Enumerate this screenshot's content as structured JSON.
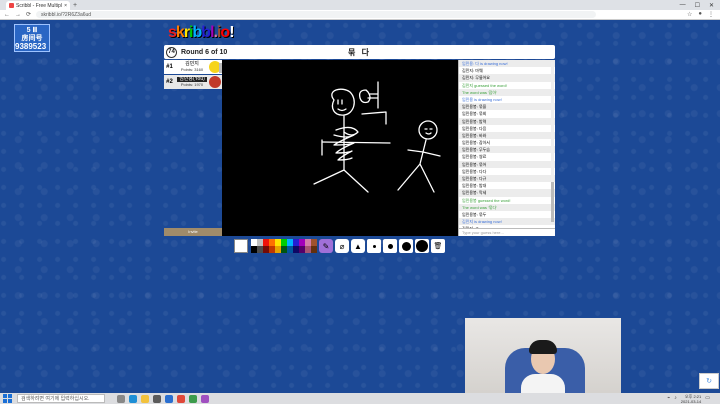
{
  "browser": {
    "tab_title": "Scribbl - Free Multiplayer Draw",
    "new_tab": "+",
    "url": "skribbl.io/?2R6Z3a6ud",
    "nav_back": "←",
    "nav_fwd": "→",
    "nav_reload": "⟳",
    "win_min": "—",
    "win_max": "☐",
    "win_close": "✕"
  },
  "sticker": {
    "line1": "5 Ⅲ",
    "line2": "房间号",
    "room_number": "9389523"
  },
  "logo": {
    "letters": [
      "s",
      "k",
      "r",
      "i",
      "b",
      "b",
      "l",
      ".",
      "i",
      "o",
      "!"
    ],
    "colors": [
      "#ef1f1f",
      "#ff7c00",
      "#ffe400",
      "#00cc00",
      "#00b2ff",
      "#231fd3",
      "#a300ba",
      "#d37caa",
      "#a0522d",
      "#ff0000",
      "#ffffff"
    ]
  },
  "header": {
    "timer": "74",
    "round": "Round 6 of 10",
    "word": "묶 다"
  },
  "players": [
    {
      "rank": "#1",
      "name": "김민지",
      "points": "Points: 3160",
      "avatar": "y"
    },
    {
      "rank": "#2",
      "name": "임민용(You)",
      "points": "Points: 1970",
      "avatar": "r"
    }
  ],
  "under_label": "Invite",
  "chat": {
    "messages": [
      {
        "text": "임민용: 다 is drawing now!",
        "cls": "b"
      },
      {
        "text": "김민지: 마웨",
        "cls": ""
      },
      {
        "text": "김민지: 무릎어요",
        "cls": ""
      },
      {
        "text": "김민지 guessed the word!",
        "cls": "g"
      },
      {
        "text": "The word was '잡아'",
        "cls": "g"
      },
      {
        "text": "임민용 is drawing now!",
        "cls": "b"
      },
      {
        "text": "임민용봉: 묶을",
        "cls": ""
      },
      {
        "text": "임민용봉: 묶회",
        "cls": ""
      },
      {
        "text": "임민용봉: 밤력",
        "cls": ""
      },
      {
        "text": "임민용봉: 다음",
        "cls": ""
      },
      {
        "text": "임민용봉: 바와",
        "cls": ""
      },
      {
        "text": "임민용봉: 잡아서",
        "cls": ""
      },
      {
        "text": "임민용봉: 무두습",
        "cls": ""
      },
      {
        "text": "임민용봉: 쌍료",
        "cls": ""
      },
      {
        "text": "임민용봉: 묶어",
        "cls": ""
      },
      {
        "text": "임민용봉: 다다",
        "cls": ""
      },
      {
        "text": "임민용봉: 다규",
        "cls": ""
      },
      {
        "text": "임민용봉: 밤대",
        "cls": ""
      },
      {
        "text": "임민용봉: 막세",
        "cls": ""
      },
      {
        "text": "임민용봉 guessed the word!",
        "cls": "g"
      },
      {
        "text": "The word was '묶다'",
        "cls": "g"
      },
      {
        "text": "임민용봉: 묶두",
        "cls": ""
      },
      {
        "text": "김민지 is drawing now!",
        "cls": "b"
      },
      {
        "text": "김민지: ㅎ",
        "cls": ""
      }
    ],
    "input_placeholder": "Type your guess here..."
  },
  "palette": [
    "#ffffff",
    "#c1c1c1",
    "#ef130b",
    "#ff7100",
    "#ffe400",
    "#00cc00",
    "#00b2ff",
    "#231fd3",
    "#a300ba",
    "#d37caa",
    "#a0522d",
    "#000000",
    "#4c4c4c",
    "#740b07",
    "#c23800",
    "#e8a200",
    "#005510",
    "#00569e",
    "#0e0865",
    "#550069",
    "#a75574",
    "#63300d"
  ],
  "tools": {
    "brush": "✎",
    "fill": "▲",
    "trash": "🗑"
  },
  "taskbar": {
    "search_placeholder": "검색하려면 여기에 입력하십시오.",
    "time": "오후 2:21",
    "date": "2021-03-14"
  },
  "recaptcha": "↻"
}
